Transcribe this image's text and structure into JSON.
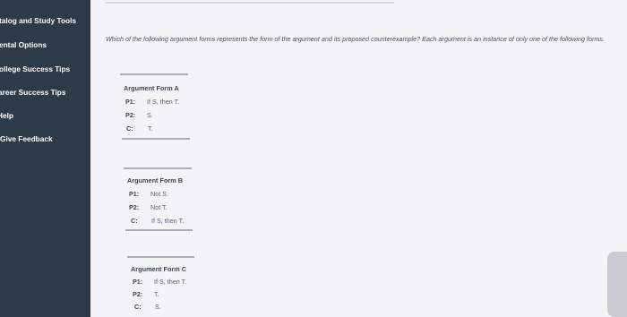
{
  "sidebar": {
    "items": [
      {
        "label": "talog and Study Tools"
      },
      {
        "label": "ental Options"
      },
      {
        "label": "ollege Success Tips"
      },
      {
        "label": "areer Success Tips"
      },
      {
        "label": "Help"
      },
      {
        "label": "Give Feedback"
      }
    ]
  },
  "question": {
    "text": "Which of the following argument forms represents the form of the argument and its proposed counterexample? Each argument is an instance of only one of the following forms."
  },
  "forms": [
    {
      "title": "Argument Form A",
      "rows": [
        {
          "label": "P1:",
          "value": "If S, then T."
        },
        {
          "label": "P2:",
          "value": "S."
        },
        {
          "label": "C:",
          "value": "T."
        }
      ]
    },
    {
      "title": "Argument Form B",
      "rows": [
        {
          "label": "P1:",
          "value": "Not S."
        },
        {
          "label": "P2:",
          "value": "Not T."
        },
        {
          "label": "C:",
          "value": "If S, then T."
        }
      ]
    },
    {
      "title": "Argument Form C",
      "rows": [
        {
          "label": "P1:",
          "value": "If S, then T."
        },
        {
          "label": "P2:",
          "value": "T."
        },
        {
          "label": "C:",
          "value": "S."
        }
      ]
    }
  ]
}
